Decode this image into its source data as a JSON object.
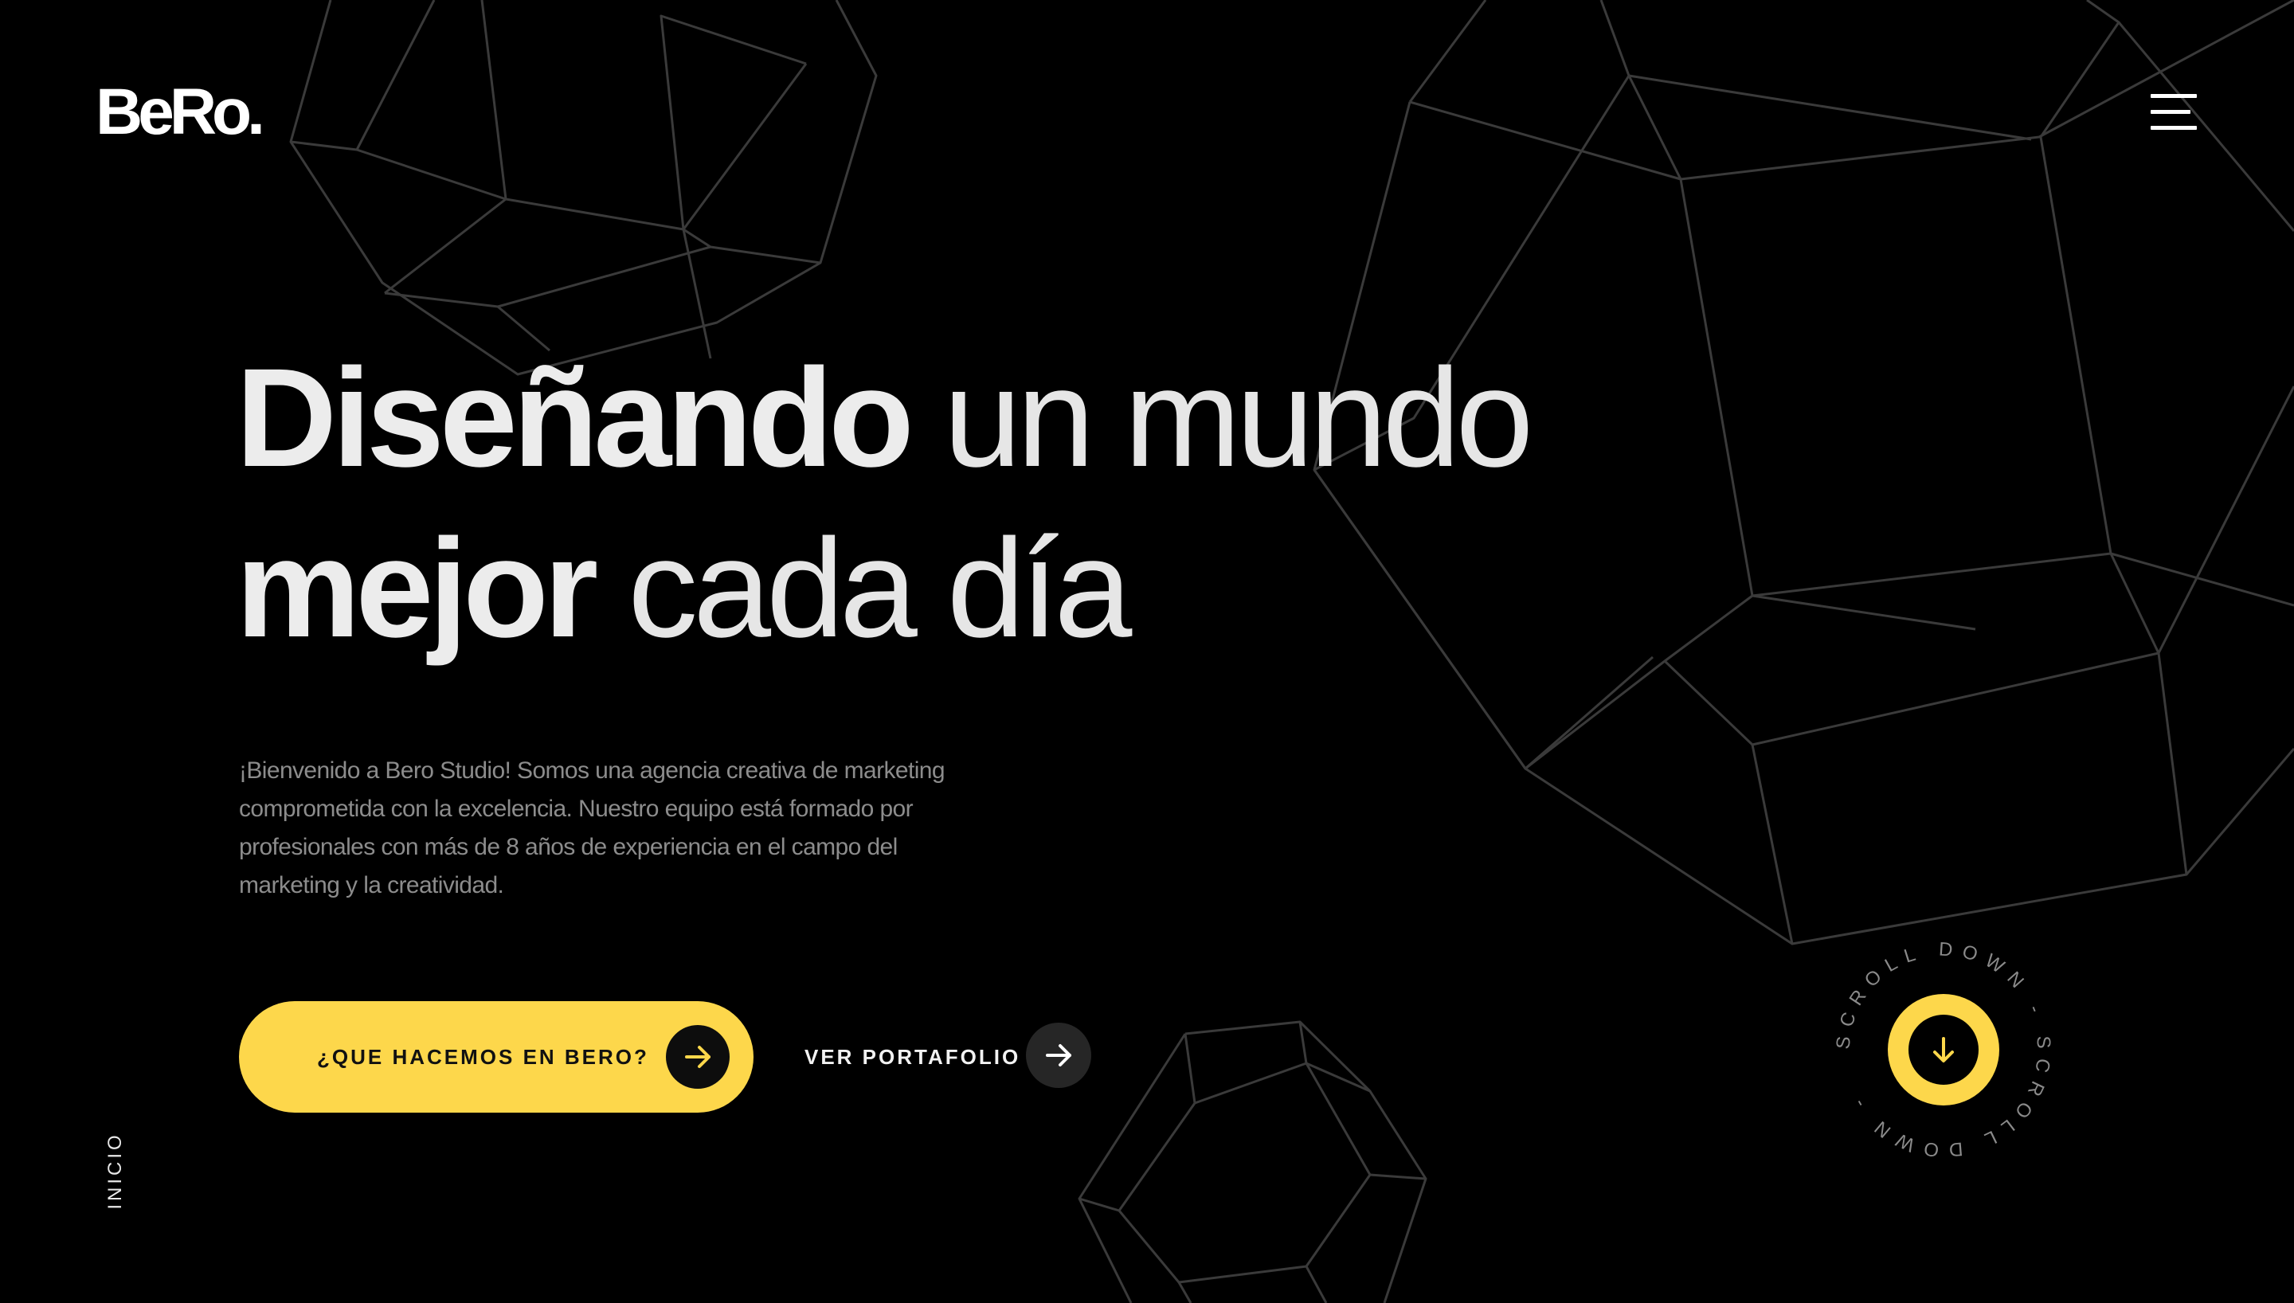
{
  "brand": {
    "logo_text": "BeRo."
  },
  "nav": {
    "menu_icon": "hamburger-menu-icon"
  },
  "hero": {
    "line1_bold": "Diseñando",
    "line1_light": "un mundo",
    "line2_bold": "mejor",
    "line2_light": "cada día",
    "intro": "¡Bienvenido a Bero Studio! Somos una agencia creativa de marketing comprometida con la excelencia. Nuestro equipo está formado por profesionales con más de 8 años de experiencia en el campo del marketing y la creatividad."
  },
  "actions": {
    "primary_label": "¿QUE HACEMOS EN BERO?",
    "primary_icon": "arrow-right-icon",
    "secondary_label": "VER PORTAFOLIO",
    "secondary_icon": "arrow-right-icon"
  },
  "side": {
    "section_label": "INICIO"
  },
  "scroll": {
    "ring_text": "SCROLL DOWN - SCROLL DOWN - ",
    "icon": "arrow-down-icon"
  },
  "colors": {
    "background": "#000000",
    "accent": "#fdd74b",
    "heading": "#ececec",
    "body_text": "#8c8c8c",
    "line_art": "#3a3a3a"
  }
}
